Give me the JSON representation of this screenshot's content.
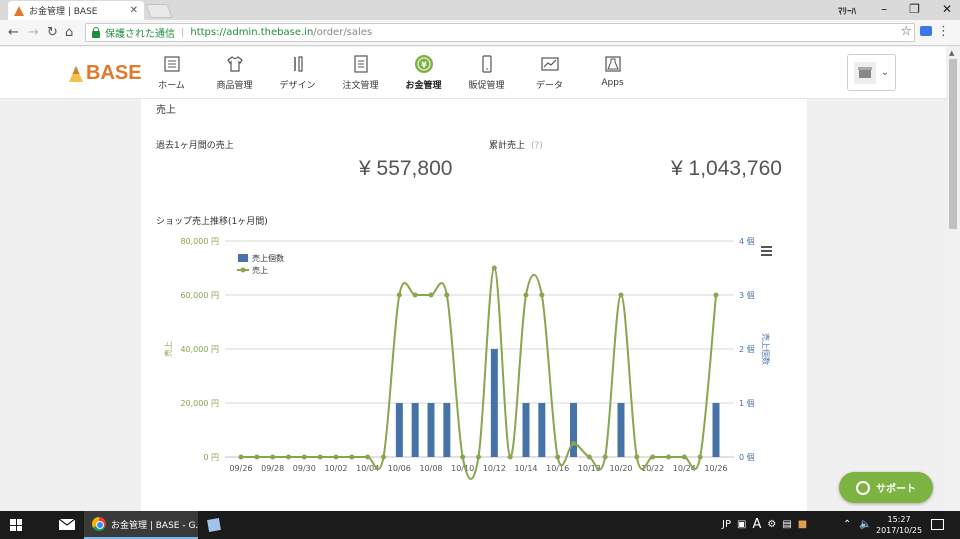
{
  "browser": {
    "tab_title": "お金管理 | BASE",
    "profile_label": "ﾏﾘｰﾊ",
    "secure_label": "保護された通信",
    "url_host": "https://admin.thebase.in",
    "url_path": "/order/sales"
  },
  "site": {
    "logo_text": "BASE",
    "nav": [
      {
        "label": "ホーム",
        "icon": "home-list-icon"
      },
      {
        "label": "商品管理",
        "icon": "tshirt-icon"
      },
      {
        "label": "デザイン",
        "icon": "tools-icon"
      },
      {
        "label": "注文管理",
        "icon": "document-icon"
      },
      {
        "label": "お金管理",
        "icon": "yen-coin-icon",
        "active": true
      },
      {
        "label": "販促管理",
        "icon": "phone-icon"
      },
      {
        "label": "データ",
        "icon": "chart-line-icon"
      },
      {
        "label": "Apps",
        "icon": "flask-icon"
      }
    ]
  },
  "sales": {
    "section_title": "売上",
    "last_month_label": "過去1ヶ月間の売上",
    "last_month_value": "¥ 557,800",
    "total_label": "累計売上",
    "total_help": "(?)",
    "total_value": "¥ 1,043,760",
    "chart_title": "ショップ売上推移(1ヶ月間)"
  },
  "chart_data": {
    "type": "bar",
    "categories": [
      "09/26",
      "09/27",
      "09/28",
      "09/29",
      "09/30",
      "10/01",
      "10/02",
      "10/03",
      "10/04",
      "10/05",
      "10/06",
      "10/07",
      "10/08",
      "10/09",
      "10/10",
      "10/11",
      "10/12",
      "10/13",
      "10/14",
      "10/15",
      "10/16",
      "10/17",
      "10/18",
      "10/19",
      "10/20",
      "10/21",
      "10/22",
      "10/23",
      "10/24",
      "10/25",
      "10/26"
    ],
    "tick_labels": [
      "09/26",
      "09/28",
      "09/30",
      "10/02",
      "10/04",
      "10/06",
      "10/08",
      "10/10",
      "10/12",
      "10/14",
      "10/16",
      "10/18",
      "10/20",
      "10/22",
      "10/24",
      "10/26"
    ],
    "series": [
      {
        "name": "売上個数",
        "type": "bar",
        "axis": "right",
        "color": "#4572a7",
        "values": [
          0,
          0,
          0,
          0,
          0,
          0,
          0,
          0,
          0,
          0,
          1,
          1,
          1,
          1,
          0,
          0,
          2,
          0,
          1,
          1,
          0,
          1,
          0,
          0,
          1,
          0,
          0,
          0,
          0,
          0,
          1
        ]
      },
      {
        "name": "売上",
        "type": "spline",
        "axis": "left",
        "color": "#89a54e",
        "values": [
          0,
          0,
          0,
          0,
          0,
          0,
          0,
          0,
          0,
          0,
          60000,
          60000,
          60000,
          60000,
          0,
          0,
          70000,
          0,
          60000,
          60000,
          0,
          5000,
          0,
          0,
          60000,
          0,
          0,
          0,
          0,
          0,
          60000
        ]
      }
    ],
    "ylabel_left": "売上",
    "ylabel_right": "売上個数",
    "left_ticks": [
      "0 円",
      "20,000 円",
      "40,000 円",
      "60,000 円",
      "80,000 円"
    ],
    "right_ticks": [
      "0 個",
      "1 個",
      "2 個",
      "3 個",
      "4 個"
    ],
    "ylim_left": [
      0,
      80000
    ],
    "ylim_right": [
      0,
      4
    ],
    "legend_position": "top-left",
    "grid": true
  },
  "support_label": "サポート",
  "taskbar": {
    "chrome_task": "お金管理 | BASE - G...",
    "ime": "JP",
    "ime_mode": "A",
    "time": "15:27",
    "date": "2017/10/25"
  }
}
